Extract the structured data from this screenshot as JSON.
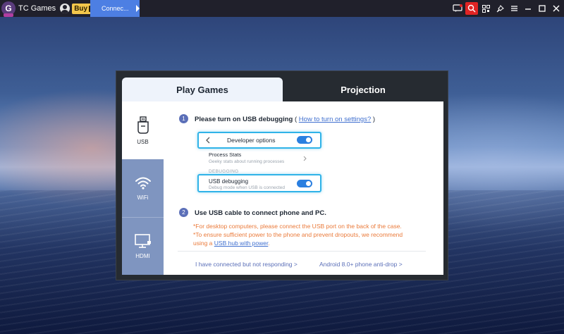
{
  "titlebar": {
    "logo_letter": "G",
    "app_name": "TC Games",
    "buy_label": "Buy",
    "vip_label": "V",
    "connection_tab": "Connec..."
  },
  "dialog": {
    "tabs": {
      "play_games": "Play Games",
      "projection": "Projection"
    },
    "sidebar": {
      "usb": "USB",
      "wifi": "WiFi",
      "hdmi": "HDMI"
    },
    "step1": {
      "number": "1",
      "title": "Please turn on USB debugging",
      "paren_open": " ( ",
      "link": "How to turn on settings?",
      "paren_close": " )"
    },
    "phone_mock": {
      "developer_options": "Developer options",
      "process_stats": "Process Stats",
      "process_stats_sub": "Geeky stats about running processes",
      "section_label": "DEBUGGING",
      "usb_debugging": "USB debugging",
      "usb_debugging_sub": "Debug mode when USB is connected"
    },
    "step2": {
      "number": "2",
      "title": "Use USB cable to connect phone and PC.",
      "note1": "*For desktop computers, please connect the USB port on the back of the case.",
      "note2": "*To ensure sufficient power to the phone and prevent dropouts, we recommend",
      "note3_prefix": "using a ",
      "note3_link": "USB hub with power",
      "note3_suffix": "."
    },
    "footer": {
      "not_responding": "I have connected but not responding >",
      "anti_drop": "Android 8.0+ phone anti-drop >"
    }
  },
  "colors": {
    "accent": "#4d7fe3",
    "highlight_border": "#30b3e8",
    "warning_text": "#ea7a3a",
    "sidebar": "#7f95c0",
    "step_badge": "#5b6fb8"
  }
}
